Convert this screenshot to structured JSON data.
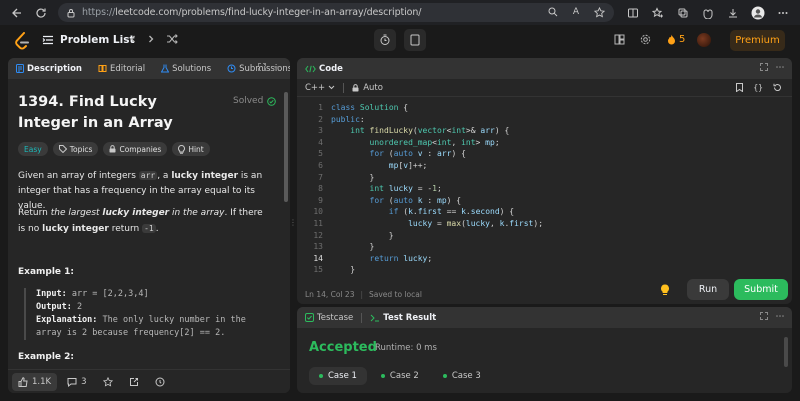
{
  "browser": {
    "url_prefix": "https://",
    "url_main": "leetcode.com/problems/find-lucky-integer-in-an-array/description/"
  },
  "nav": {
    "problem_list": "Problem List",
    "streak": "5",
    "premium": "Premium"
  },
  "desc": {
    "tabs": [
      "Description",
      "Editorial",
      "Solutions",
      "Submissions"
    ],
    "title": "1394. Find Lucky Integer in an Array",
    "solved": "Solved",
    "tags": [
      "Easy",
      "Topics",
      "Companies",
      "Hint"
    ],
    "p1_a": "Given an array of integers ",
    "p1_code": "arr",
    "p1_b": ", a ",
    "p1_bold": "lucky integer",
    "p1_c": " is an integer that has a frequency in the array equal to its value.",
    "p2_a": "Return ",
    "p2_em": "the largest ",
    "p2_embold": "lucky integer",
    "p2_em2": " in the array",
    "p2_b": ". If there is no ",
    "p2_bold": "lucky integer",
    "p2_c": " return ",
    "p2_code": "-1",
    "p2_d": ".",
    "example1": "Example 1:",
    "input_label": "Input:",
    "input_value": " arr = [2,2,3,4]",
    "output_label": "Output:",
    "output_value": " 2",
    "expl_label": "Explanation:",
    "expl_value": " The only lucky number in the array is 2 because frequency[2] == 2.",
    "example2": "Example 2:",
    "likes": "1.1K",
    "comments": "3"
  },
  "code": {
    "tab": "Code",
    "lang": "C++",
    "auto": "Auto",
    "line_numbers": [
      "1",
      "2",
      "3",
      "4",
      "5",
      "6",
      "7",
      "8",
      "9",
      "10",
      "11",
      "12",
      "13",
      "14",
      "15"
    ],
    "status_pos": "Ln 14, Col 23",
    "status_saved": "Saved to local",
    "run": "Run",
    "submit": "Submit"
  },
  "result": {
    "tabs": [
      "Testcase",
      "Test Result"
    ],
    "status": "Accepted",
    "runtime": "Runtime: 0 ms",
    "cases": [
      "Case 1",
      "Case 2",
      "Case 3"
    ]
  },
  "colors": {
    "accepted": "#2cbb5d",
    "premium": "#ffa116",
    "easy": "#1cbaba"
  }
}
